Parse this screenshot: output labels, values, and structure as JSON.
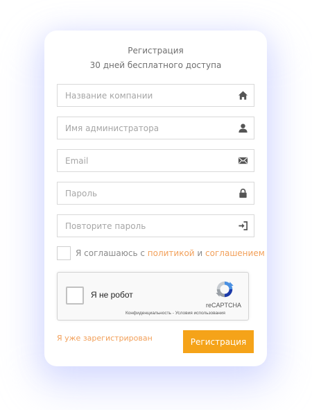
{
  "form": {
    "title": "Регистрация",
    "subtitle": "30 дней бесплатного доступа",
    "fields": [
      {
        "placeholder": "Название компании",
        "icon": "home-icon"
      },
      {
        "placeholder": "Имя администратора",
        "icon": "user-icon"
      },
      {
        "placeholder": "Email",
        "icon": "envelope-icon"
      },
      {
        "placeholder": "Пароль",
        "icon": "lock-icon"
      },
      {
        "placeholder": "Повторите пароль",
        "icon": "sign-in-icon"
      }
    ],
    "agree": {
      "prefix": "Я соглашаюсь с ",
      "policy_link": "политикой",
      "conjunction": " и ",
      "agreement_link": "соглашением"
    },
    "captcha": {
      "label": "Я не робот",
      "brand": "reCAPTCHA",
      "links": "Конфиденциальность - Условия использования"
    },
    "login_link": "Я уже зарегистрирован",
    "submit_label": "Регистрация"
  },
  "colors": {
    "accent": "#f5a319",
    "link": "#f2a05a",
    "text": "#6f6f6f",
    "border": "#d9d9d9",
    "icon": "#555555"
  }
}
